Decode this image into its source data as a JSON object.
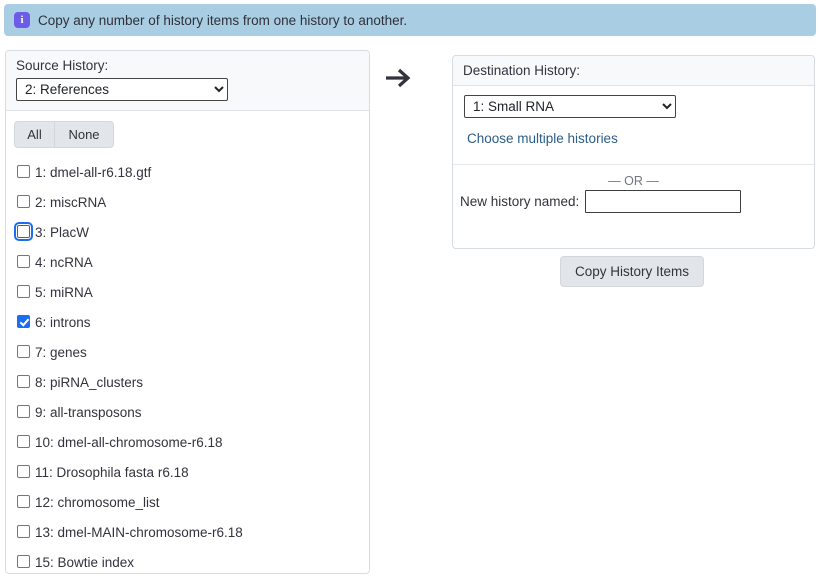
{
  "banner": {
    "icon": "info-icon",
    "text": "Copy any number of history items from one history to another.",
    "background_color": "#a9cde3",
    "icon_color": "#6c5ce7"
  },
  "source_panel": {
    "label": "Source History:",
    "selected_history": "2: References",
    "select_options": [
      "2: References"
    ],
    "buttons": {
      "all": "All",
      "none": "None"
    },
    "items": [
      {
        "label": "1: dmel-all-r6.18.gtf",
        "checked": false,
        "focused": false
      },
      {
        "label": "2: miscRNA",
        "checked": false,
        "focused": false
      },
      {
        "label": "3: PlacW",
        "checked": false,
        "focused": true
      },
      {
        "label": "4: ncRNA",
        "checked": false,
        "focused": false
      },
      {
        "label": "5: miRNA",
        "checked": false,
        "focused": false
      },
      {
        "label": "6: introns",
        "checked": true,
        "focused": false
      },
      {
        "label": "7: genes",
        "checked": false,
        "focused": false
      },
      {
        "label": "8: piRNA_clusters",
        "checked": false,
        "focused": false
      },
      {
        "label": "9: all-transposons",
        "checked": false,
        "focused": false
      },
      {
        "label": "10: dmel-all-chromosome-r6.18",
        "checked": false,
        "focused": false
      },
      {
        "label": "11: Drosophila fasta r6.18",
        "checked": false,
        "focused": false
      },
      {
        "label": "12: chromosome_list",
        "checked": false,
        "focused": false
      },
      {
        "label": "13: dmel-MAIN-chromosome-r6.18",
        "checked": false,
        "focused": false
      },
      {
        "label": "15: Bowtie index",
        "checked": false,
        "focused": false
      }
    ]
  },
  "arrow": {
    "icon": "arrow-right-icon"
  },
  "destination_panel": {
    "label": "Destination History:",
    "selected_history": "1: Small RNA",
    "select_options": [
      "1: Small RNA"
    ],
    "multi_link": "Choose multiple histories",
    "or_text": "— OR —",
    "new_history_label": "New history named:",
    "new_history_value": "",
    "new_history_placeholder": ""
  },
  "copy_button": {
    "label": "Copy History Items"
  },
  "colors": {
    "accent_blue": "#1b6ef3",
    "link_blue": "#2b5d87",
    "banner_blue": "#a9cde3",
    "panel_border": "#d7dce1",
    "panel_head_bg": "#f8f9fa",
    "button_bg": "#e2e6ea"
  }
}
